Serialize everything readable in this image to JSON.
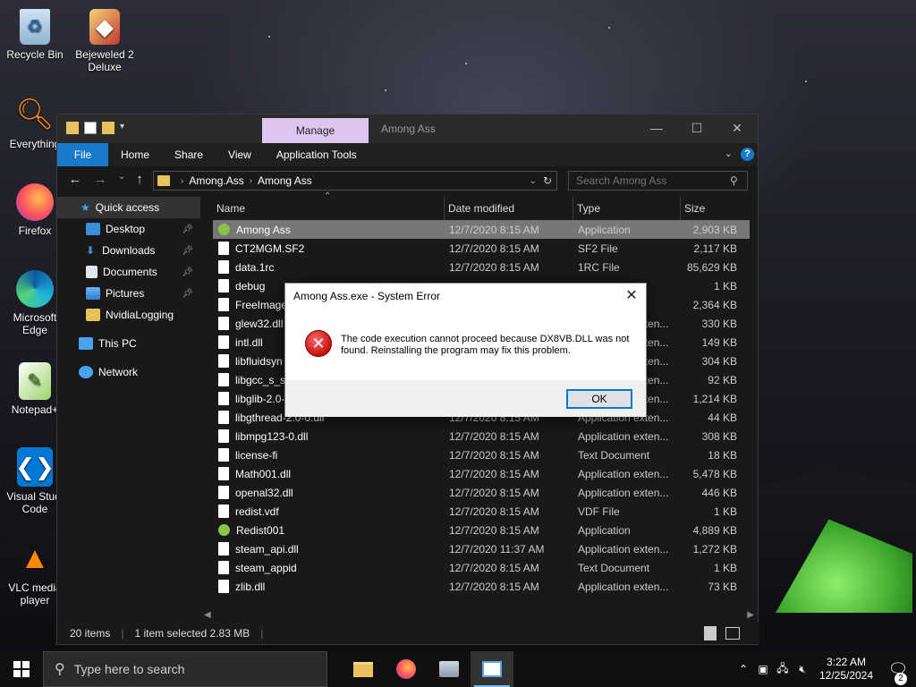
{
  "desktop": {
    "icons": [
      {
        "label": "Recycle Bin"
      },
      {
        "label": "Bejeweled 2 Deluxe"
      },
      {
        "label": "Everything"
      },
      {
        "label": "Firefox"
      },
      {
        "label": "Microsoft Edge"
      },
      {
        "label": "Notepad+"
      },
      {
        "label": "Visual Studi Code"
      },
      {
        "label": "VLC media player"
      }
    ]
  },
  "explorer": {
    "manage_tab": "Manage",
    "window_title": "Among Ass",
    "ribbon": {
      "file": "File",
      "home": "Home",
      "share": "Share",
      "view": "View",
      "app_tools": "Application Tools"
    },
    "address": {
      "crumb1": "Among.Ass",
      "crumb2": "Among Ass"
    },
    "search_placeholder": "Search Among Ass",
    "nav": {
      "quick_access": "Quick access",
      "desktop": "Desktop",
      "downloads": "Downloads",
      "documents": "Documents",
      "pictures": "Pictures",
      "nvidia": "NvidiaLogging",
      "this_pc": "This PC",
      "network": "Network"
    },
    "columns": {
      "name": "Name",
      "date": "Date modified",
      "type": "Type",
      "size": "Size"
    },
    "files": [
      {
        "name": "Among Ass",
        "date": "12/7/2020 8:15 AM",
        "type": "Application",
        "size": "2,903 KB"
      },
      {
        "name": "CT2MGM.SF2",
        "date": "12/7/2020 8:15 AM",
        "type": "SF2 File",
        "size": "2,117 KB"
      },
      {
        "name": "data.1rc",
        "date": "12/7/2020 8:15 AM",
        "type": "1RC File",
        "size": "85,629 KB"
      },
      {
        "name": "debug",
        "date": "",
        "type": "",
        "size": "1 KB"
      },
      {
        "name": "FreeImage",
        "date": "",
        "type": "",
        "size": "2,364 KB"
      },
      {
        "name": "glew32.dll",
        "date": "",
        "type": "Application exten...",
        "size": "330 KB"
      },
      {
        "name": "intl.dll",
        "date": "",
        "type": "Application exten...",
        "size": "149 KB"
      },
      {
        "name": "libfluidsyn",
        "date": "",
        "type": "Application exten...",
        "size": "304 KB"
      },
      {
        "name": "libgcc_s_sj",
        "date": "",
        "type": "Application exten...",
        "size": "92 KB"
      },
      {
        "name": "libglib-2.0-",
        "date": "",
        "type": "Application exten...",
        "size": "1,214 KB"
      },
      {
        "name": "libgthread-2.0-0.dll",
        "date": "12/7/2020 8:15 AM",
        "type": "Application exten...",
        "size": "44 KB"
      },
      {
        "name": "libmpg123-0.dll",
        "date": "12/7/2020 8:15 AM",
        "type": "Application exten...",
        "size": "308 KB"
      },
      {
        "name": "license-fi",
        "date": "12/7/2020 8:15 AM",
        "type": "Text Document",
        "size": "18 KB"
      },
      {
        "name": "Math001.dll",
        "date": "12/7/2020 8:15 AM",
        "type": "Application exten...",
        "size": "5,478 KB"
      },
      {
        "name": "openal32.dll",
        "date": "12/7/2020 8:15 AM",
        "type": "Application exten...",
        "size": "446 KB"
      },
      {
        "name": "redist.vdf",
        "date": "12/7/2020 8:15 AM",
        "type": "VDF File",
        "size": "1 KB"
      },
      {
        "name": "Redist001",
        "date": "12/7/2020 8:15 AM",
        "type": "Application",
        "size": "4,889 KB"
      },
      {
        "name": "steam_api.dll",
        "date": "12/7/2020 11:37 AM",
        "type": "Application exten...",
        "size": "1,272 KB"
      },
      {
        "name": "steam_appid",
        "date": "12/7/2020 8:15 AM",
        "type": "Text Document",
        "size": "1 KB"
      },
      {
        "name": "zlib.dll",
        "date": "12/7/2020 8:15 AM",
        "type": "Application exten...",
        "size": "73 KB"
      }
    ],
    "status": {
      "count": "20 items",
      "selected": "1 item selected  2.83 MB"
    }
  },
  "dialog": {
    "title": "Among Ass.exe - System Error",
    "message": "The code execution cannot proceed because DX8VB.DLL was not found. Reinstalling the program may fix this problem.",
    "ok": "OK"
  },
  "taskbar": {
    "search_placeholder": "Type here to search",
    "time": "3:22 AM",
    "date": "12/25/2024",
    "notifications": "2"
  }
}
